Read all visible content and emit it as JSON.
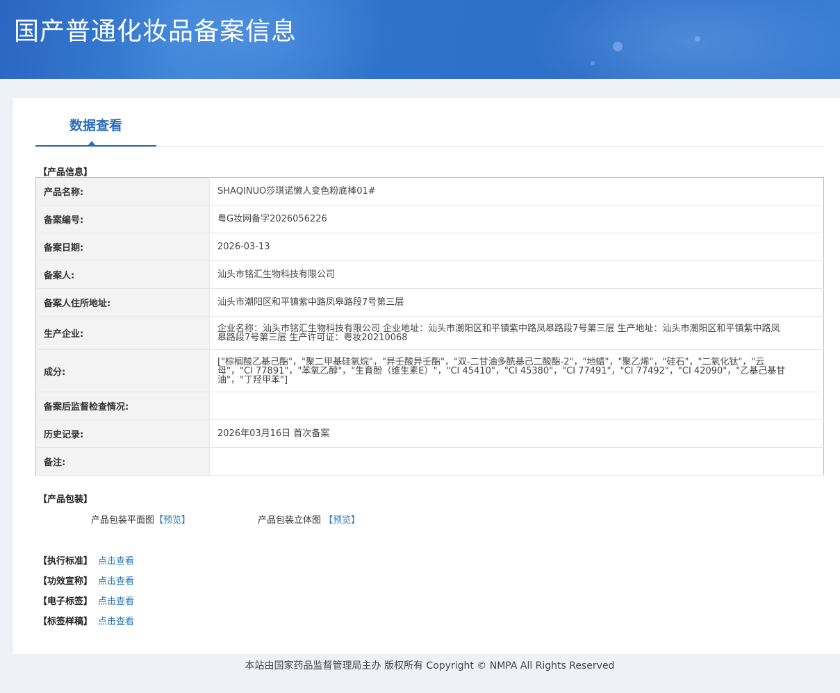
{
  "banner": {
    "title": "国产普通化妆品备案信息"
  },
  "tabs": [
    {
      "label": "数据查看"
    }
  ],
  "product_info": {
    "heading": "【产品信息】",
    "rows": [
      {
        "label": "产品名称:",
        "value": "SHAQINUO莎琪诺懒人变色粉底棒01#"
      },
      {
        "label": "备案编号:",
        "value": "粤G妆网备字2026056226"
      },
      {
        "label": "备案日期:",
        "value": "2026-03-13"
      },
      {
        "label": "备案人:",
        "value": "汕头市铭汇生物科技有限公司"
      },
      {
        "label": "备案人住所地址:",
        "value": "汕头市潮阳区和平镇紫中路凤皋路段7号第三层"
      },
      {
        "label": "生产企业:",
        "value": "企业名称：汕头市铭汇生物科技有限公司 企业地址：汕头市潮阳区和平镇紫中路凤皋路段7号第三层 生产地址：汕头市潮阳区和平镇紫中路凤皋路段7号第三层 生产许可证：粤妆20210068"
      },
      {
        "label": "成分:",
        "value": "[\"棕榈酸乙基己酯\"，\"聚二甲基硅氧烷\"，\"异壬酸异壬酯\"，\"双-二甘油多酰基己二酸酯-2\"，\"地蜡\"，\"聚乙烯\"，\"硅石\"，\"二氧化钛\"，\"云母\"，\"CI 77891\"，\"苯氧乙醇\"，\"生育酚（维生素E）\"，\"CI 45410\"，\"CI 45380\"，\"CI 77491\"，\"CI 77492\"，\"CI 42090\"，\"乙基己基甘油\"，\"丁羟甲苯\"]"
      },
      {
        "label": "备案后监督检查情况:",
        "value": ""
      },
      {
        "label": "历史记录:",
        "value": "2026年03月16日 首次备案"
      },
      {
        "label": "备注:",
        "value": ""
      }
    ]
  },
  "packaging": {
    "heading": "【产品包装】",
    "flat_label": "产品包装平面图",
    "flat_link": "【预览】",
    "three_d_label": "产品包装立体图",
    "three_d_link": "【预览】"
  },
  "extras": [
    {
      "label": "【执行标准】",
      "link": "点击查看"
    },
    {
      "label": "【功效宣称】",
      "link": "点击查看"
    },
    {
      "label": "【电子标签】",
      "link": "点击查看"
    },
    {
      "label": "【标签样稿】",
      "link": "点击查看"
    }
  ],
  "footer": {
    "text": "本站由国家药品监督管理局主办 版权所有 Copyright © NMPA All Rights Reserved"
  }
}
